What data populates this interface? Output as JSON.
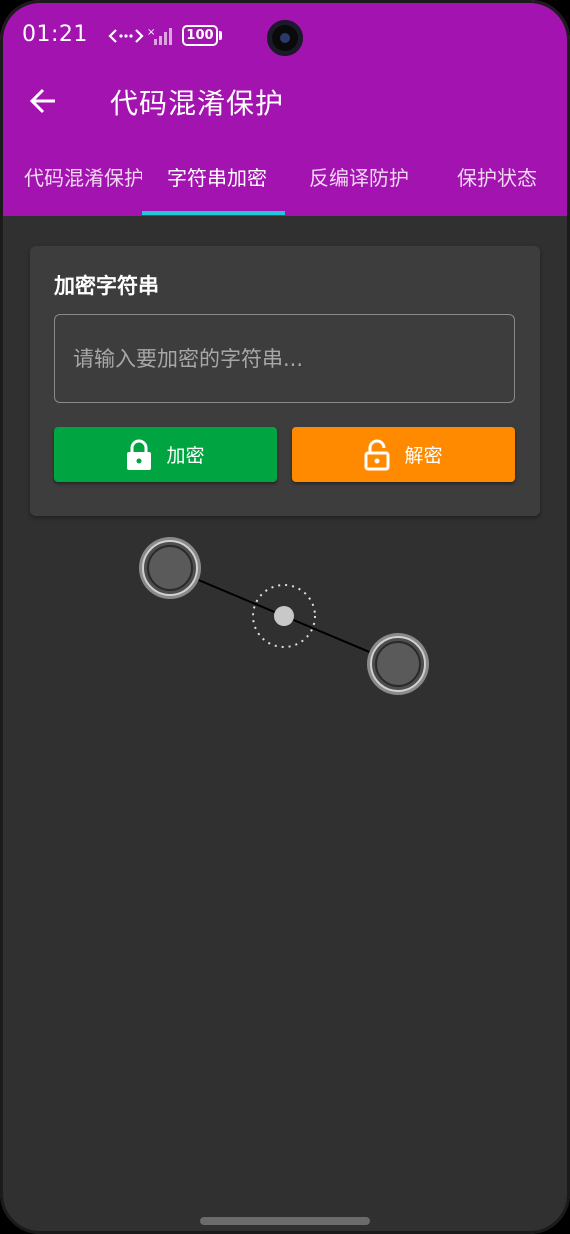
{
  "status_bar": {
    "time": "01:21",
    "battery": "100",
    "icons": [
      "data-transfer-icon",
      "signal-icon",
      "battery-icon"
    ]
  },
  "app_bar": {
    "title": "代码混淆保护",
    "back_icon": "arrow-left-icon",
    "background": "#a313b0"
  },
  "tabs": [
    {
      "label": "代码混淆保护",
      "active": false
    },
    {
      "label": "字符串加密",
      "active": true
    },
    {
      "label": "反编译防护",
      "active": false
    },
    {
      "label": "保护状态",
      "active": false
    }
  ],
  "tab_indicator_color": "#26c6da",
  "card": {
    "title": "加密字符串",
    "input": {
      "value": "",
      "placeholder": "请输入要加密的字符串..."
    },
    "encrypt_button": {
      "label": "加密",
      "icon": "lock-icon",
      "color": "#00a542"
    },
    "decrypt_button": {
      "label": "解密",
      "icon": "unlock-icon",
      "color": "#ff8a00"
    }
  },
  "overlay": {
    "icons": [
      "drag-handle-start-icon",
      "drag-center-icon",
      "drag-handle-end-icon"
    ]
  }
}
